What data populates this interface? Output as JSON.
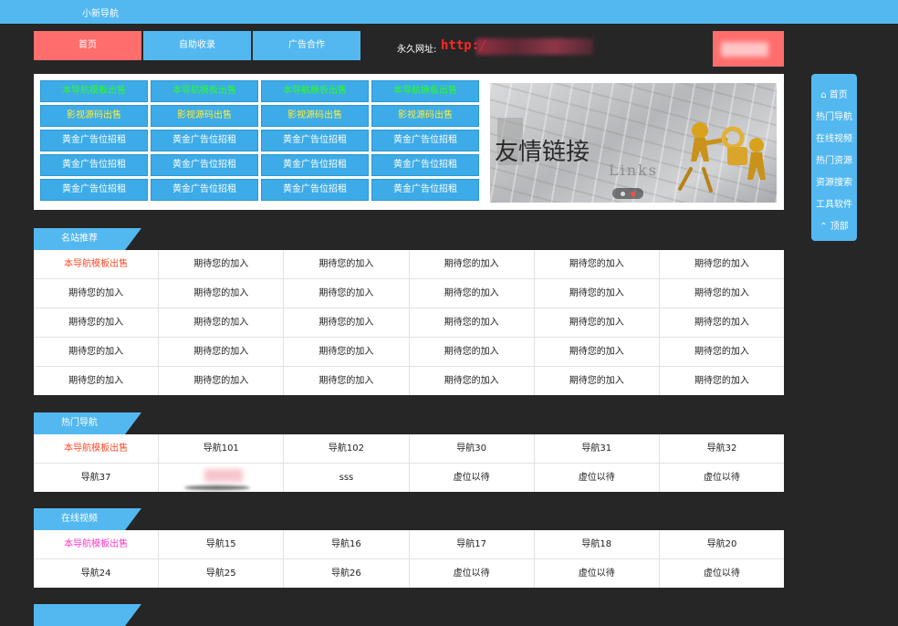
{
  "header": {
    "site_title": "小新导航"
  },
  "nav": {
    "items": [
      {
        "label": "首页"
      },
      {
        "label": "自助收录"
      },
      {
        "label": "广告合作"
      }
    ],
    "url_label": "永久网址:",
    "url_value": "http:/"
  },
  "ads": {
    "rows": [
      [
        "本导航模板出售",
        "本导航模板出售",
        "本导航模板出售",
        "本导航模板出售"
      ],
      [
        "影视源码出售",
        "影视源码出售",
        "影视源码出售",
        "影视源码出售"
      ],
      [
        "黄金广告位招租",
        "黄金广告位招租",
        "黄金广告位招租",
        "黄金广告位招租"
      ],
      [
        "黄金广告位招租",
        "黄金广告位招租",
        "黄金广告位招租",
        "黄金广告位招租"
      ],
      [
        "黄金广告位招租",
        "黄金广告位招租",
        "黄金广告位招租",
        "黄金广告位招租"
      ]
    ],
    "row_colors": [
      "#2bff1f",
      "#ffee3a",
      "#ffffff",
      "#ffffff",
      "#ffffff"
    ]
  },
  "banner": {
    "title": "友情链接",
    "subtitle": "Links"
  },
  "sidebar": {
    "items": [
      {
        "label": "首页",
        "icon": "home-icon"
      },
      {
        "label": "热门导航"
      },
      {
        "label": "在线视频"
      },
      {
        "label": "热门资源"
      },
      {
        "label": "资源搜索"
      },
      {
        "label": "工具软件"
      },
      {
        "label": "顶部",
        "icon": "chevron-up-icon"
      }
    ]
  },
  "sections": [
    {
      "title": "名站推荐",
      "rows": [
        [
          "本导航模板出售",
          "期待您的加入",
          "期待您的加入",
          "期待您的加入",
          "期待您的加入",
          "期待您的加入"
        ],
        [
          "期待您的加入",
          "期待您的加入",
          "期待您的加入",
          "期待您的加入",
          "期待您的加入",
          "期待您的加入"
        ],
        [
          "期待您的加入",
          "期待您的加入",
          "期待您的加入",
          "期待您的加入",
          "期待您的加入",
          "期待您的加入"
        ],
        [
          "期待您的加入",
          "期待您的加入",
          "期待您的加入",
          "期待您的加入",
          "期待您的加入",
          "期待您的加入"
        ],
        [
          "期待您的加入",
          "期待您的加入",
          "期待您的加入",
          "期待您的加入",
          "期待您的加入",
          "期待您的加入"
        ]
      ]
    },
    {
      "title": "热门导航",
      "rows": [
        [
          "本导航模板出售",
          "导航101",
          "导航102",
          "导航30",
          "导航31",
          "导航32"
        ],
        [
          "导航37",
          "",
          "sss",
          "虚位以待",
          "虚位以待",
          "虚位以待"
        ]
      ]
    },
    {
      "title": "在线视频",
      "rows": [
        [
          "本导航模板出售",
          "导航15",
          "导航16",
          "导航17",
          "导航18",
          "导航20"
        ],
        [
          "导航24",
          "导航25",
          "导航26",
          "虚位以待",
          "虚位以待",
          "虚位以待"
        ]
      ]
    }
  ],
  "colors": {
    "accent_blue": "#53b8f0",
    "accent_red": "#ff6d6d",
    "background": "#262626",
    "highlight_red_text": "#ff4b2b",
    "highlight_pink_text": "#ff37c8",
    "url_red": "#ff2626"
  }
}
